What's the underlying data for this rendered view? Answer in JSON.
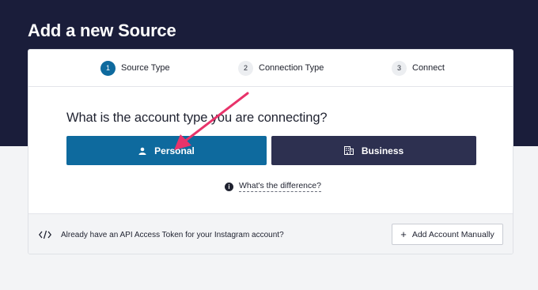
{
  "page": {
    "title": "Add a new Source"
  },
  "steps": [
    {
      "number": "1",
      "label": "Source Type",
      "active": true
    },
    {
      "number": "2",
      "label": "Connection Type",
      "active": false
    },
    {
      "number": "3",
      "label": "Connect",
      "active": false
    }
  ],
  "question": "What is the account type you are connecting?",
  "account_types": {
    "personal": {
      "label": "Personal",
      "icon": "person-icon"
    },
    "business": {
      "label": "Business",
      "icon": "building-icon"
    }
  },
  "difference_link": {
    "label": "What's the difference?",
    "icon": "info-icon"
  },
  "footer": {
    "icon": "code-icon",
    "text": "Already have an API Access Token for your Instagram account?",
    "button_label": "Add Account Manually"
  },
  "colors": {
    "header_bg": "#1a1d3a",
    "primary": "#0e6a9e",
    "business_bg": "#2d3050",
    "annotation_arrow": "#e8336a"
  }
}
